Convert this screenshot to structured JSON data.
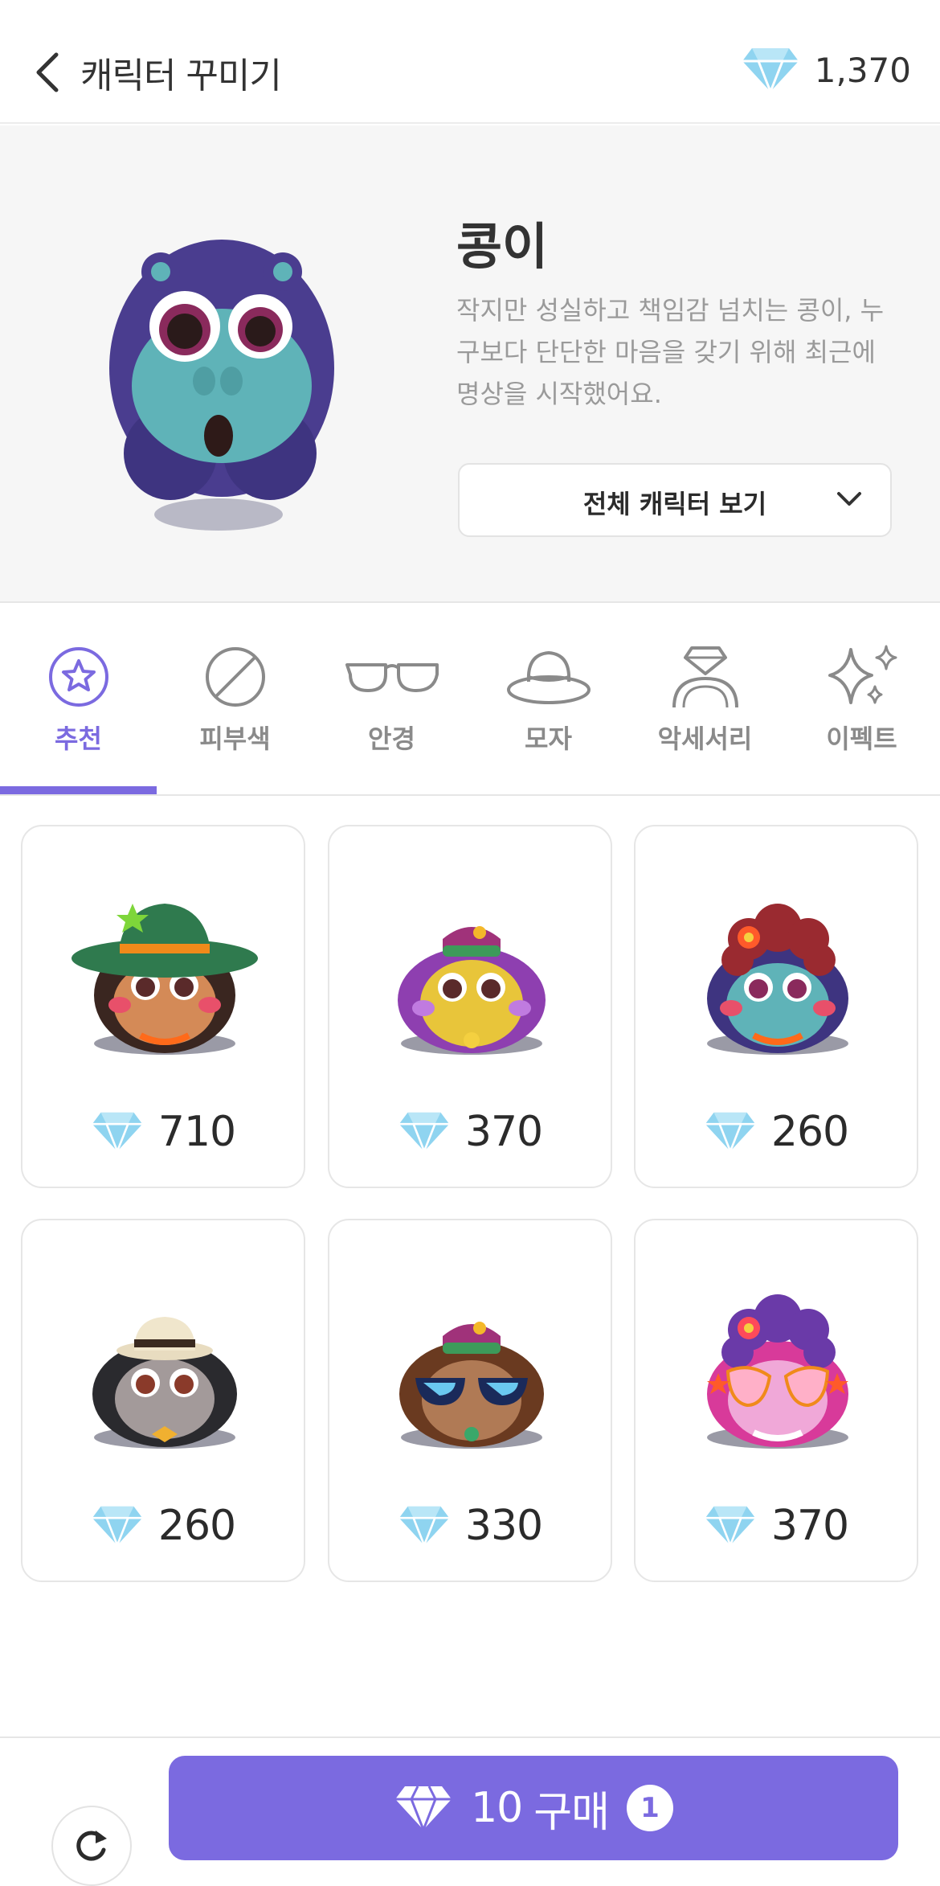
{
  "header": {
    "title": "캐릭터 꾸미기",
    "gem_balance": "1,370"
  },
  "hero": {
    "name": "콩이",
    "description": "작지만 성실하고 책임감 넘치는 콩이, 누구보다 단단한 마음을 갖기 위해 최근에 명상을 시작했어요.",
    "view_all_label": "전체 캐릭터 보기"
  },
  "tabs": [
    {
      "label": "추천",
      "icon": "star-circle-icon",
      "active": true
    },
    {
      "label": "피부색",
      "icon": "slash-circle-icon",
      "active": false
    },
    {
      "label": "안경",
      "icon": "glasses-icon",
      "active": false
    },
    {
      "label": "모자",
      "icon": "hat-icon",
      "active": false
    },
    {
      "label": "악세서리",
      "icon": "ring-icon",
      "active": false
    },
    {
      "label": "이펙트",
      "icon": "sparkle-icon",
      "active": false
    }
  ],
  "items": [
    {
      "price": "710",
      "variant": "green-hat"
    },
    {
      "price": "370",
      "variant": "purple-cap"
    },
    {
      "price": "260",
      "variant": "red-curls"
    },
    {
      "price": "260",
      "variant": "fedora"
    },
    {
      "price": "330",
      "variant": "sunglasses"
    },
    {
      "price": "370",
      "variant": "heart-glasses"
    }
  ],
  "bottom": {
    "buy_amount": "10",
    "buy_label": "구매",
    "count": "1"
  },
  "colors": {
    "accent": "#7b6ae0",
    "gem": "#8fd4f0",
    "hero_bg": "#f6f6f6"
  }
}
